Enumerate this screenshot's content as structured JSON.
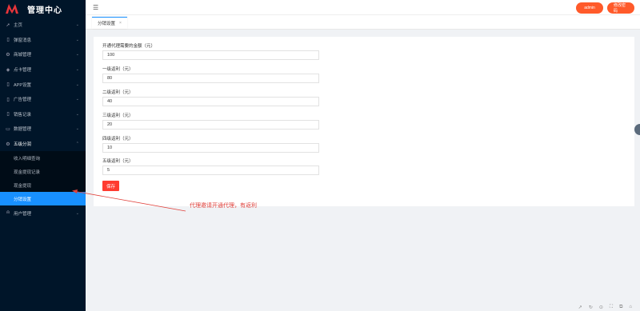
{
  "brand": {
    "title": "管理中心"
  },
  "sidebar": {
    "items": [
      {
        "icon": "send-icon",
        "glyph": "➚",
        "label": "主页",
        "arrow": "⌄"
      },
      {
        "icon": "phone-icon",
        "glyph": "▯",
        "label": "弹窗消息",
        "arrow": "⌄"
      },
      {
        "icon": "gear-icon",
        "glyph": "⚙",
        "label": "商城管理",
        "arrow": "⌄"
      },
      {
        "icon": "shield-icon",
        "glyph": "◈",
        "label": "点卡管理",
        "arrow": "⌄"
      },
      {
        "icon": "phone-icon",
        "glyph": "▯",
        "label": "APP设置",
        "arrow": "⌄"
      },
      {
        "icon": "phone-icon",
        "glyph": "▯",
        "label": "广告管理",
        "arrow": "⌄"
      },
      {
        "icon": "phone-icon",
        "glyph": "▯",
        "label": "销售记录",
        "arrow": "⌄"
      },
      {
        "icon": "monitor-icon",
        "glyph": "▭",
        "label": "数据管理",
        "arrow": "⌄"
      },
      {
        "icon": "gear-icon",
        "glyph": "⚙",
        "label": "五级分润",
        "arrow": "⌃"
      }
    ],
    "submenu": [
      {
        "label": "收入明细查询"
      },
      {
        "label": "现金提现记录"
      },
      {
        "label": "现金提现"
      },
      {
        "label": "分销设置"
      }
    ],
    "last_item": {
      "icon": "user-icon",
      "glyph": "⍝",
      "label": "用户管理",
      "arrow": "⌄"
    }
  },
  "topbar": {
    "hamburger": "☰",
    "btn1": "admin",
    "btn2": "修改密码"
  },
  "tabs": [
    {
      "label": "分销设置",
      "close": "×"
    }
  ],
  "form": {
    "fields": [
      {
        "label": "开通代理需要的金额（元）",
        "value": "100"
      },
      {
        "label": "一级返利（元）",
        "value": "80"
      },
      {
        "label": "二级返利（元）",
        "value": "40"
      },
      {
        "label": "三级返利（元）",
        "value": "20"
      },
      {
        "label": "四级返利（元）",
        "value": "10"
      },
      {
        "label": "五级返利（元）",
        "value": "5"
      }
    ],
    "save_label": "保存"
  },
  "annotation": {
    "text": "代理邀请开通代理，有返利"
  },
  "footer_icons": [
    "↗",
    "↻",
    "⊙",
    "⛶",
    "⧉",
    "⌂"
  ]
}
